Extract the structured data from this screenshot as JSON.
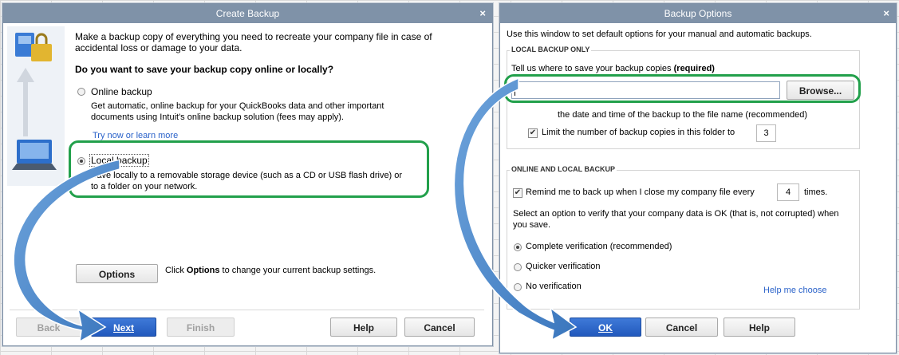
{
  "create_backup": {
    "title": "Create Backup",
    "intro": "Make a backup copy of everything you need to recreate your company file in case of accidental loss or damage to your data.",
    "question": "Do you want to save your backup copy online or locally?",
    "online": {
      "label": "Online backup",
      "description": "Get automatic, online backup for your QuickBooks data and other important documents using Intuit's online backup solution (fees may apply).",
      "link": "Try now or learn more",
      "selected": false
    },
    "local": {
      "label": "Local backup",
      "description": "Save locally to a removable storage device (such as a CD or USB flash drive) or to a folder on your network.",
      "selected": true
    },
    "options_button": "Options",
    "options_hint_pre": "Click ",
    "options_hint_bold": "Options",
    "options_hint_post": " to change your current backup settings.",
    "buttons": {
      "back": "Back",
      "next": "Next",
      "finish": "Finish",
      "help": "Help",
      "cancel": "Cancel"
    }
  },
  "backup_options": {
    "title": "Backup Options",
    "intro": "Use this window to set default options for your manual and automatic backups.",
    "local_section": {
      "heading": "LOCAL BACKUP ONLY",
      "prompt": "Tell us where to save your backup copies",
      "required": "(required)",
      "path_value": "",
      "browse": "Browse...",
      "add_date_label": "the date and time of the backup to the file name (recommended)",
      "limit_label": "Limit the number of backup copies in this folder to",
      "limit_value": "3",
      "limit_checked": true
    },
    "online_local_section": {
      "heading": "ONLINE AND LOCAL BACKUP",
      "remind_label": "Remind me to back up when I close my company file every",
      "remind_value": "4",
      "remind_suffix": "times.",
      "remind_checked": true,
      "verify_prompt": "Select an option to verify that your company data is OK (that is, not corrupted) when you save.",
      "verify_options": [
        {
          "label": "Complete verification (recommended)",
          "selected": true
        },
        {
          "label": "Quicker verification",
          "selected": false
        },
        {
          "label": "No verification",
          "selected": false
        }
      ],
      "help_link": "Help me choose"
    },
    "buttons": {
      "ok": "OK",
      "cancel": "Cancel",
      "help": "Help"
    }
  },
  "colors": {
    "titlebar": "#7f92a8",
    "highlight": "#22a04b",
    "arrow": "#4a87c8",
    "primary_button": "#2259bd",
    "link": "#2a62c9"
  },
  "icons": {
    "wizard_side": "computer-backup-illustration",
    "annotation": "curved-arrow"
  }
}
